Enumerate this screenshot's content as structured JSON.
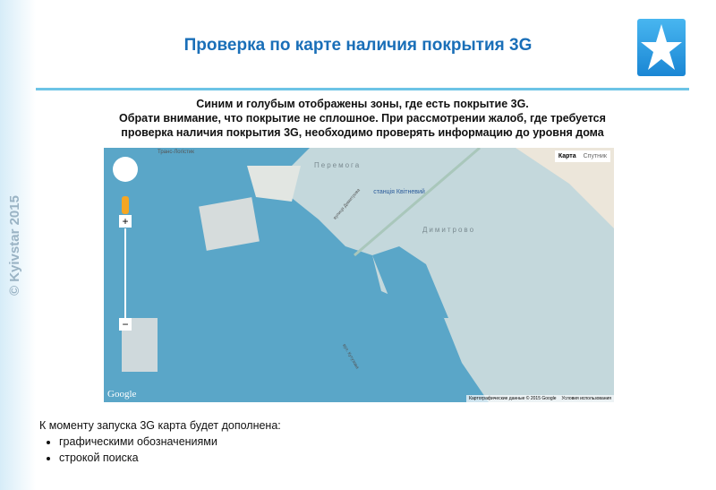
{
  "sidebar": {
    "copyright": "© Kyivstar 2015"
  },
  "header": {
    "title": "Проверка по карте наличия покрытия 3G"
  },
  "intro": {
    "lines": [
      "Синим и голубым отображены зоны, где есть покрытие 3G.",
      "Обрати внимание, что покрытие не сплошное. При рассмотрении жалоб, где требуется",
      "проверка наличия покрытия 3G, необходимо проверять информацию до уровня дома"
    ]
  },
  "map": {
    "type_buttons": [
      "Карта",
      "Спутник"
    ],
    "labels": {
      "peremoga": "Перемога",
      "dimitrovo": "Димитрово",
      "station": "станція Квітневий",
      "street1": "вулиця Димитрова",
      "street2": "вул. Кутузова",
      "top": "Транс-Логістик"
    },
    "google": "Google",
    "attribution": "Картографические данные © 2015 Google",
    "terms": "Условия использования",
    "zoom_in": "+",
    "zoom_out": "−",
    "colors": {
      "coverage": "#5aa6c8",
      "base": "#c4d8dc"
    }
  },
  "footer": {
    "text": "К моменту запуска 3G карта будет дополнена:",
    "items": [
      "графическими обозначениями",
      "строкой поиска"
    ]
  }
}
